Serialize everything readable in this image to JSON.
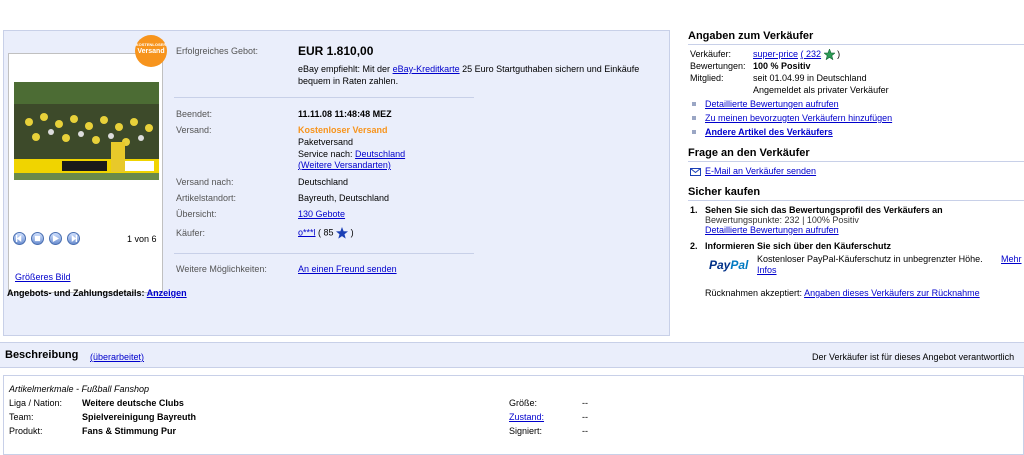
{
  "listing": {
    "winning_bid_label": "Erfolgreiches Gebot:",
    "winning_bid_value": "EUR 1.810,00",
    "recommend_prefix": "eBay empfiehlt: Mit der",
    "recommend_link": "eBay-Kreditkarte",
    "recommend_suffix_1": "25 Euro Startguthaben sichern und Einkäufe",
    "recommend_suffix_2": "bequem in Raten zahlen.",
    "ended_label": "Beendet:",
    "ended_value": "11.11.08 11:48:48 MEZ",
    "shipping_label": "Versand:",
    "shipping_free": "Kostenloser Versand",
    "shipping_type": "Paketversand",
    "service_to_label": "Service nach:",
    "service_to_link": "Deutschland",
    "more_shipping_link": "(Weitere Versandarten)",
    "ship_to_label": "Versand nach:",
    "ship_to_value": "Deutschland",
    "location_label": "Artikelstandort:",
    "location_value": "Bayreuth, Deutschland",
    "overview_label": "Übersicht:",
    "overview_link": "130 Gebote",
    "buyer_label": "Käufer:",
    "buyer_name": "o***l",
    "buyer_score_open": "( 85",
    "buyer_score_close": ")",
    "more_options_label": "Weitere Möglichkeiten:",
    "send_friend_link": "An einen Freund senden",
    "details_label": "Angebots- und Zahlungsdetails:",
    "details_link": "Anzeigen"
  },
  "photo": {
    "badge_top": "KOSTENLOSER",
    "badge_main": "Versand",
    "page_count": "1 von 6",
    "bigger_link": "Größeres Bild"
  },
  "seller": {
    "title": "Angaben zum Verkäufer",
    "seller_label": "Verkäufer:",
    "seller_name": "super-price",
    "seller_score_open": "( 232",
    "seller_score_close": ")",
    "ratings_label": "Bewertungen:",
    "ratings_value": "100 % Positiv",
    "member_label": "Mitglied:",
    "member_value_1": "seit 01.04.99 in Deutschland",
    "member_value_2": "Angemeldet als privater Verkäufer",
    "link_1": "Detaillierte Bewertungen aufrufen",
    "link_2": "Zu meinen bevorzugten Verkäufern hinzufügen",
    "link_3": "Andere Artikel des Verkäufers"
  },
  "question": {
    "title": "Frage an den Verkäufer",
    "email_link": "E-Mail an Verkäufer senden"
  },
  "safe": {
    "title": "Sicher kaufen",
    "item1_num": "1.",
    "item1_title": "Sehen Sie sich das Bewertungsprofil des Verkäufers an",
    "item1_line": "Bewertungspunkte: 232 | 100% Positiv",
    "item1_link": "Detaillierte Bewertungen aufrufen",
    "item2_num": "2.",
    "item2_title": "Informieren Sie sich über den Käuferschutz",
    "paypal_logo_1": "Pay",
    "paypal_logo_2": "Pal",
    "paypal_text": "Kostenloser PayPal-Käuferschutz in unbegrenzter Höhe.",
    "paypal_more_1": "Mehr",
    "paypal_more_2": "Infos",
    "returns_label": "Rücknahmen akzeptiert:",
    "returns_link": "Angaben dieses Verkäufers zur Rücknahme"
  },
  "description": {
    "title": "Beschreibung",
    "revised": "(überarbeitet)",
    "seller_responsible": "Der Verkäufer ist für dieses Angebot verantwortlich",
    "attributes_title": "Artikelmerkmale - Fußball Fanshop",
    "rows": [
      {
        "label": "Liga / Nation:",
        "value": "Weitere deutsche Clubs"
      },
      {
        "label": "Team:",
        "value": "Spielvereinigung Bayreuth"
      },
      {
        "label": "Produkt:",
        "value": "Fans & Stimmung Pur"
      }
    ],
    "right_rows": [
      {
        "label": "Größe:",
        "value": "--"
      },
      {
        "label": "Zustand:",
        "value": "--"
      },
      {
        "label": "Signiert:",
        "value": "--"
      }
    ]
  },
  "colors": {
    "panel_bg": "#eaeefb",
    "link": "#0000cc",
    "orange": "#f7941d",
    "star": "#2d9b56"
  },
  "icons": [
    "previous-icon",
    "stop-icon",
    "play-icon",
    "next-icon",
    "star-icon",
    "mail-icon"
  ]
}
